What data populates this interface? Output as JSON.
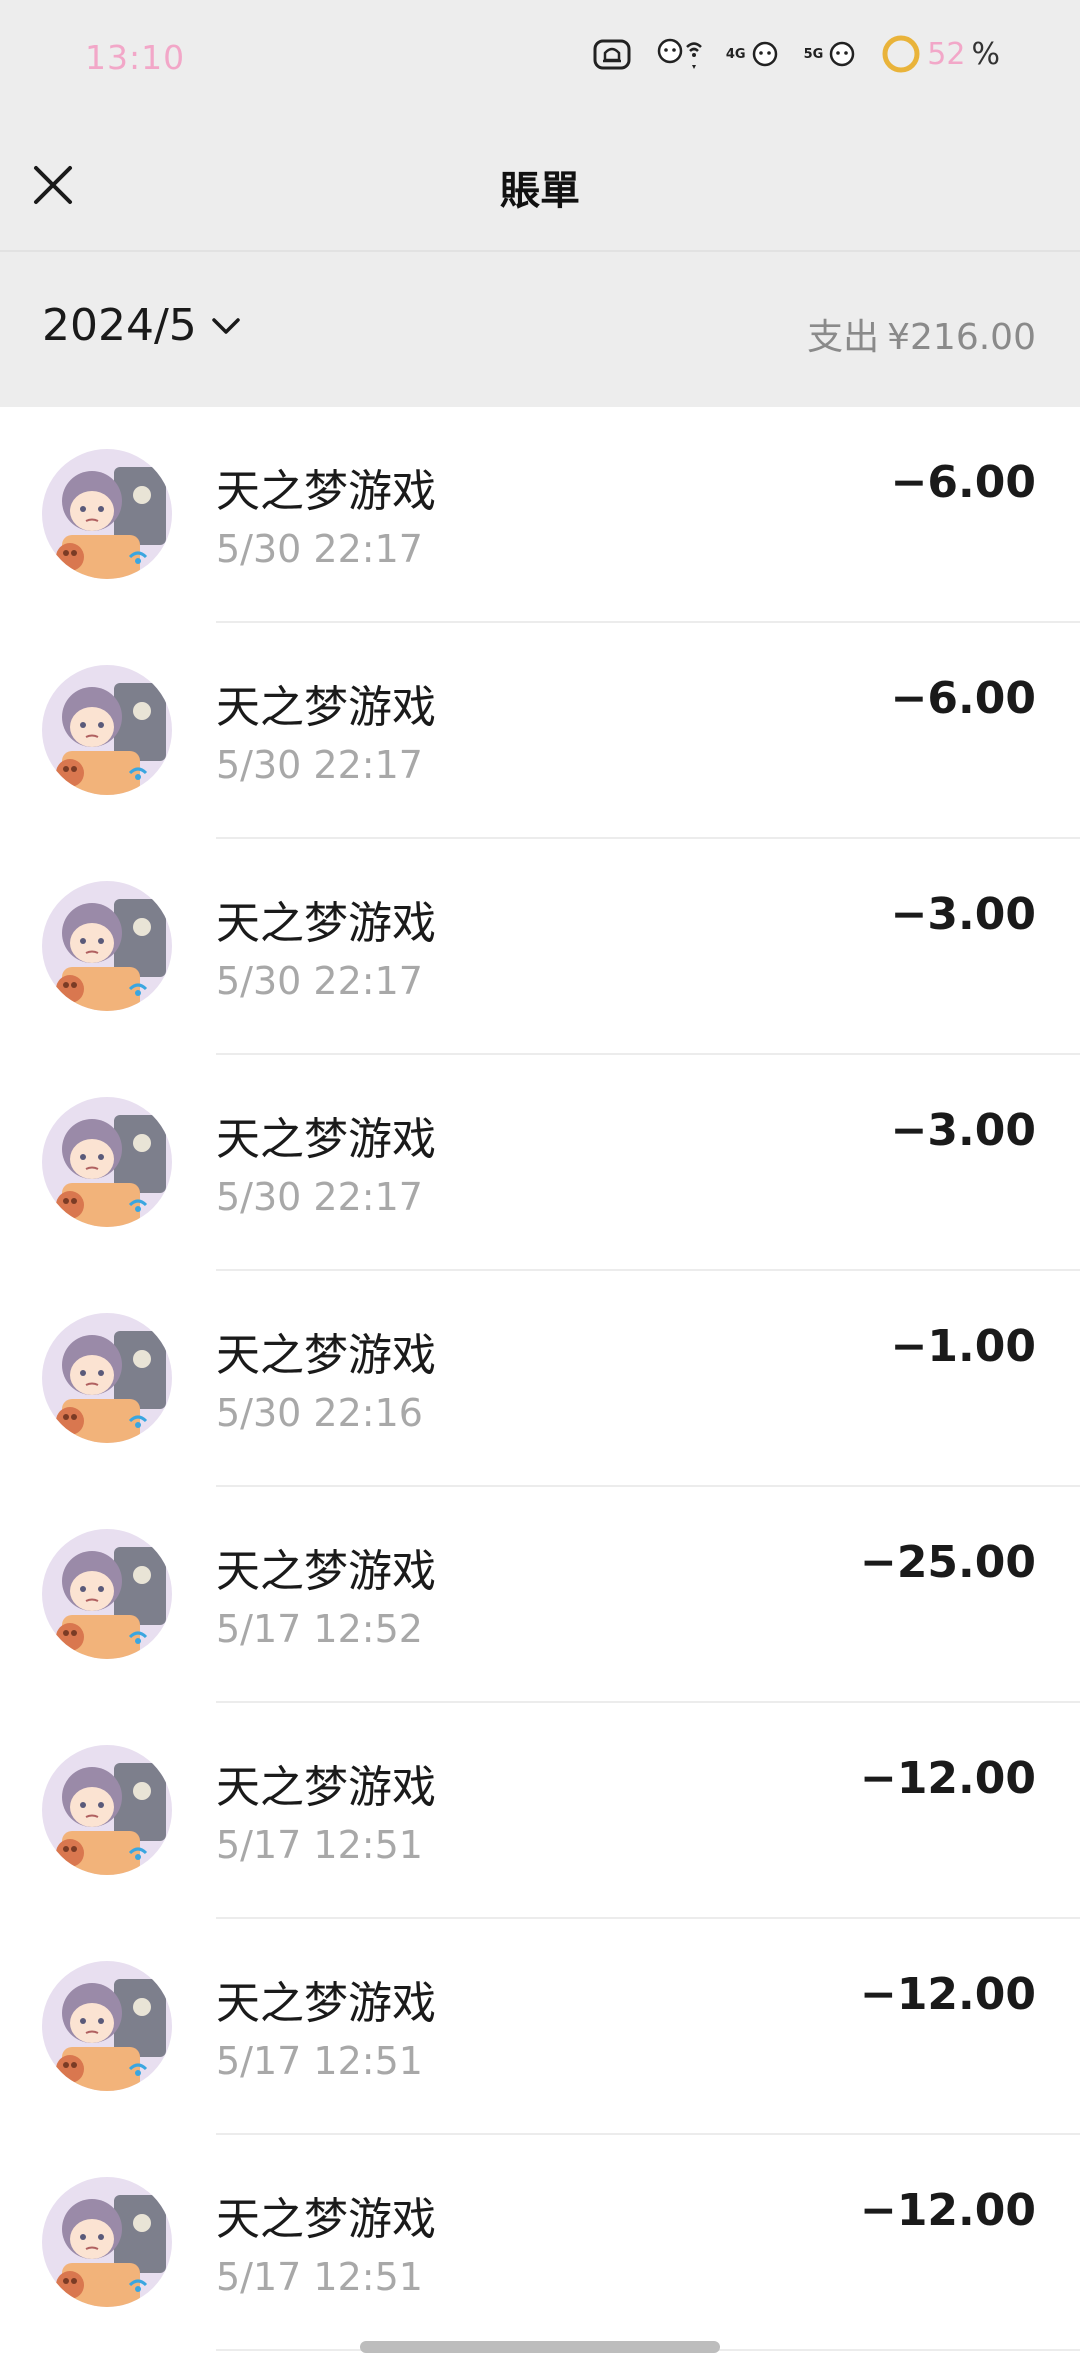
{
  "status_bar": {
    "time": "13:10",
    "network_1": "4G",
    "network_2": "5G",
    "battery_value": "52",
    "battery_suffix": "%"
  },
  "nav": {
    "title": "賬單",
    "close_icon": "close-icon"
  },
  "summary": {
    "month": "2024/5",
    "label": "支出",
    "amount": "¥216.00"
  },
  "transactions": [
    {
      "merchant": "天之梦游戏",
      "time": "5/30 22:17",
      "amount": "−6.00"
    },
    {
      "merchant": "天之梦游戏",
      "time": "5/30 22:17",
      "amount": "−6.00"
    },
    {
      "merchant": "天之梦游戏",
      "time": "5/30 22:17",
      "amount": "−3.00"
    },
    {
      "merchant": "天之梦游戏",
      "time": "5/30 22:17",
      "amount": "−3.00"
    },
    {
      "merchant": "天之梦游戏",
      "time": "5/30 22:16",
      "amount": "−1.00"
    },
    {
      "merchant": "天之梦游戏",
      "time": "5/17 12:52",
      "amount": "−25.00"
    },
    {
      "merchant": "天之梦游戏",
      "time": "5/17 12:51",
      "amount": "−12.00"
    },
    {
      "merchant": "天之梦游戏",
      "time": "5/17 12:51",
      "amount": "−12.00"
    },
    {
      "merchant": "天之梦游戏",
      "time": "5/17 12:51",
      "amount": "−12.00"
    }
  ],
  "colors": {
    "header_bg": "#ededed",
    "list_bg": "#ffffff",
    "time_pink": "#f2a7c8",
    "secondary_text": "#a8a8a8"
  }
}
